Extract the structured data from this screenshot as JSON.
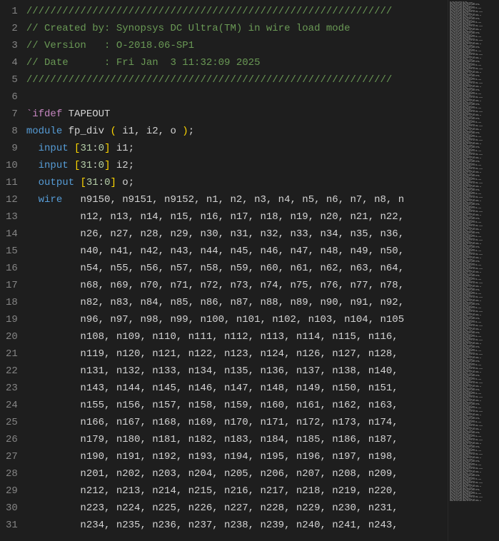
{
  "lines": [
    {
      "num": 1,
      "tokens": [
        {
          "cls": "comment",
          "t": "/////////////////////////////////////////////////////////////"
        }
      ]
    },
    {
      "num": 2,
      "tokens": [
        {
          "cls": "comment",
          "t": "// Created by: Synopsys DC Ultra(TM) in wire load mode"
        }
      ]
    },
    {
      "num": 3,
      "tokens": [
        {
          "cls": "comment",
          "t": "// Version   : O-2018.06-SP1"
        }
      ]
    },
    {
      "num": 4,
      "tokens": [
        {
          "cls": "comment",
          "t": "// Date      : Fri Jan  3 11:32:09 2025"
        }
      ]
    },
    {
      "num": 5,
      "tokens": [
        {
          "cls": "comment",
          "t": "/////////////////////////////////////////////////////////////"
        }
      ]
    },
    {
      "num": 6,
      "tokens": []
    },
    {
      "num": 7,
      "tokens": [
        {
          "cls": "backtick",
          "t": "`"
        },
        {
          "cls": "keyword-ifdef",
          "t": "ifdef"
        },
        {
          "cls": "",
          "t": " "
        },
        {
          "cls": "macro-name",
          "t": "TAPEOUT"
        }
      ]
    },
    {
      "num": 8,
      "tokens": [
        {
          "cls": "keyword-module",
          "t": "module"
        },
        {
          "cls": "",
          "t": " "
        },
        {
          "cls": "ident",
          "t": "fp_div"
        },
        {
          "cls": "",
          "t": " "
        },
        {
          "cls": "bracket",
          "t": "("
        },
        {
          "cls": "",
          "t": " i1, i2, o "
        },
        {
          "cls": "bracket",
          "t": ")"
        },
        {
          "cls": "punct",
          "t": ";"
        }
      ]
    },
    {
      "num": 9,
      "tokens": [
        {
          "cls": "",
          "t": "  "
        },
        {
          "cls": "keyword-io",
          "t": "input"
        },
        {
          "cls": "",
          "t": " "
        },
        {
          "cls": "bracket",
          "t": "["
        },
        {
          "cls": "number",
          "t": "31"
        },
        {
          "cls": "punct",
          "t": ":"
        },
        {
          "cls": "number",
          "t": "0"
        },
        {
          "cls": "bracket",
          "t": "]"
        },
        {
          "cls": "",
          "t": " i1;"
        }
      ]
    },
    {
      "num": 10,
      "tokens": [
        {
          "cls": "",
          "t": "  "
        },
        {
          "cls": "keyword-io",
          "t": "input"
        },
        {
          "cls": "",
          "t": " "
        },
        {
          "cls": "bracket",
          "t": "["
        },
        {
          "cls": "number",
          "t": "31"
        },
        {
          "cls": "punct",
          "t": ":"
        },
        {
          "cls": "number",
          "t": "0"
        },
        {
          "cls": "bracket",
          "t": "]"
        },
        {
          "cls": "",
          "t": " i2;"
        }
      ]
    },
    {
      "num": 11,
      "tokens": [
        {
          "cls": "",
          "t": "  "
        },
        {
          "cls": "keyword-io",
          "t": "output"
        },
        {
          "cls": "",
          "t": " "
        },
        {
          "cls": "bracket",
          "t": "["
        },
        {
          "cls": "number",
          "t": "31"
        },
        {
          "cls": "punct",
          "t": ":"
        },
        {
          "cls": "number",
          "t": "0"
        },
        {
          "cls": "bracket",
          "t": "]"
        },
        {
          "cls": "",
          "t": " o;"
        }
      ]
    },
    {
      "num": 12,
      "tokens": [
        {
          "cls": "",
          "t": "  "
        },
        {
          "cls": "keyword-wire",
          "t": "wire"
        },
        {
          "cls": "",
          "t": "   n9150, n9151, n9152, n1, n2, n3, n4, n5, n6, n7, n8, n"
        }
      ]
    },
    {
      "num": 13,
      "tokens": [
        {
          "cls": "",
          "t": "         n12, n13, n14, n15, n16, n17, n18, n19, n20, n21, n22,"
        }
      ]
    },
    {
      "num": 14,
      "tokens": [
        {
          "cls": "",
          "t": "         n26, n27, n28, n29, n30, n31, n32, n33, n34, n35, n36,"
        }
      ]
    },
    {
      "num": 15,
      "tokens": [
        {
          "cls": "",
          "t": "         n40, n41, n42, n43, n44, n45, n46, n47, n48, n49, n50,"
        }
      ]
    },
    {
      "num": 16,
      "tokens": [
        {
          "cls": "",
          "t": "         n54, n55, n56, n57, n58, n59, n60, n61, n62, n63, n64,"
        }
      ]
    },
    {
      "num": 17,
      "tokens": [
        {
          "cls": "",
          "t": "         n68, n69, n70, n71, n72, n73, n74, n75, n76, n77, n78,"
        }
      ]
    },
    {
      "num": 18,
      "tokens": [
        {
          "cls": "",
          "t": "         n82, n83, n84, n85, n86, n87, n88, n89, n90, n91, n92,"
        }
      ]
    },
    {
      "num": 19,
      "tokens": [
        {
          "cls": "",
          "t": "         n96, n97, n98, n99, n100, n101, n102, n103, n104, n105"
        }
      ]
    },
    {
      "num": 20,
      "tokens": [
        {
          "cls": "",
          "t": "         n108, n109, n110, n111, n112, n113, n114, n115, n116,"
        }
      ]
    },
    {
      "num": 21,
      "tokens": [
        {
          "cls": "",
          "t": "         n119, n120, n121, n122, n123, n124, n126, n127, n128,"
        }
      ]
    },
    {
      "num": 22,
      "tokens": [
        {
          "cls": "",
          "t": "         n131, n132, n133, n134, n135, n136, n137, n138, n140,"
        }
      ]
    },
    {
      "num": 23,
      "tokens": [
        {
          "cls": "",
          "t": "         n143, n144, n145, n146, n147, n148, n149, n150, n151,"
        }
      ]
    },
    {
      "num": 24,
      "tokens": [
        {
          "cls": "",
          "t": "         n155, n156, n157, n158, n159, n160, n161, n162, n163,"
        }
      ]
    },
    {
      "num": 25,
      "tokens": [
        {
          "cls": "",
          "t": "         n166, n167, n168, n169, n170, n171, n172, n173, n174,"
        }
      ]
    },
    {
      "num": 26,
      "tokens": [
        {
          "cls": "",
          "t": "         n179, n180, n181, n182, n183, n184, n185, n186, n187,"
        }
      ]
    },
    {
      "num": 27,
      "tokens": [
        {
          "cls": "",
          "t": "         n190, n191, n192, n193, n194, n195, n196, n197, n198,"
        }
      ]
    },
    {
      "num": 28,
      "tokens": [
        {
          "cls": "",
          "t": "         n201, n202, n203, n204, n205, n206, n207, n208, n209,"
        }
      ]
    },
    {
      "num": 29,
      "tokens": [
        {
          "cls": "",
          "t": "         n212, n213, n214, n215, n216, n217, n218, n219, n220,"
        }
      ]
    },
    {
      "num": 30,
      "tokens": [
        {
          "cls": "",
          "t": "         n223, n224, n225, n226, n227, n228, n229, n230, n231,"
        }
      ]
    },
    {
      "num": 31,
      "tokens": [
        {
          "cls": "",
          "t": "         n234, n235, n236, n237, n238, n239, n240, n241, n243,"
        }
      ]
    }
  ]
}
